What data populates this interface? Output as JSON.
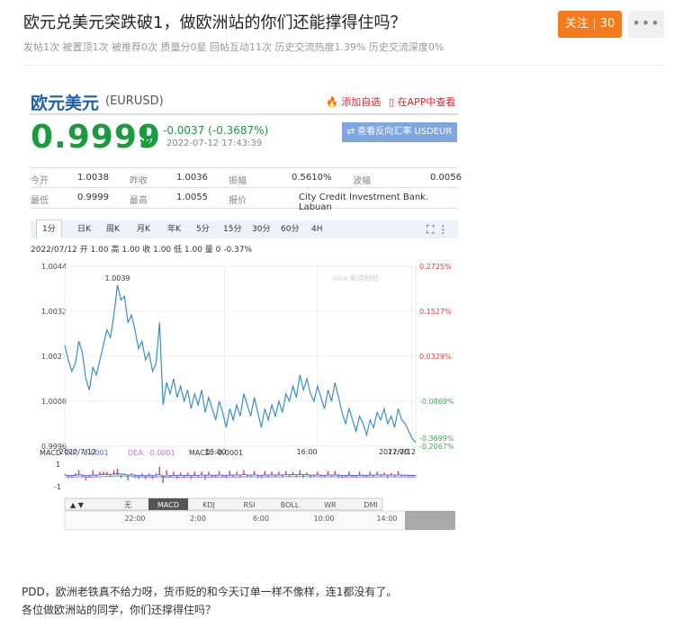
{
  "post": {
    "title": "欧元兑美元突跌破1，做欧洲站的你们还能撑得住吗？",
    "meta": "发帖1次 被置顶1次 被推荐0次 质量分0星 回帖互动11次 历史交流热度1.39% 历史交流深度0%",
    "follow_label": "关注",
    "follow_count": "30",
    "more_label": "•••",
    "body_lines": [
      "PDD，欧洲老铁真不给力呀，货币贬的和今天订单一样不像样，连1都没有了。",
      "各位做欧洲站的同学，你们还撑得住吗？"
    ]
  },
  "quote": {
    "name": "欧元美元",
    "code": "(EURUSD)",
    "add_fav": "添加自选",
    "app_view": "在APP中查看",
    "price": "0.9999",
    "arrow": "↓",
    "change": "-0.0037 (-0.3687%)",
    "datetime": "2022-07-12 17:43:39",
    "reverse_btn": "⇄ 查看反向汇率 USDEUR",
    "rows": [
      [
        [
          "今开",
          "1.0038"
        ],
        [
          "昨收",
          "1.0036"
        ],
        [
          "振幅",
          "0.5610%"
        ],
        [
          "波幅",
          "0.0056"
        ]
      ],
      [
        [
          "最低",
          "0.9999"
        ],
        [
          "最高",
          "1.0055"
        ],
        [
          "报价",
          "City Credit Investment Bank. Labuan"
        ]
      ]
    ],
    "tabs": [
      "1分",
      "日K",
      "周K",
      "月K",
      "年K",
      "5分",
      "15分",
      "30分",
      "60分",
      "4H"
    ],
    "ohlc": "2022/07/12 开 1.00 高 1.00 收 1.00 低 1.00 量 0 -0.37%",
    "tool_icons": "⛶  ⋮",
    "watermark": "sina 新浪财经",
    "indicator_tabs": [
      "无",
      "MACD",
      "KDJ",
      "RSI",
      "BOLL",
      "WR",
      "DMI"
    ],
    "nav_arrows": "▲ ▼",
    "macd": {
      "label": "MACD",
      "dif": "DIF: -0.0001",
      "dea": "DEA: -0.0001",
      "macd": "MACD: -0.0001",
      "y_ticks": [
        "1",
        "-1"
      ]
    }
  },
  "chart_data": {
    "type": "line",
    "title": "",
    "y_ticks_left": [
      "1.0044",
      "1.0032",
      "1.002",
      "1.0008",
      "0.9996"
    ],
    "y_ticks_right": [
      "0.2725%",
      "0.1527%",
      "0.0329%",
      "-0.0869%",
      "-0.2067%"
    ],
    "x_ticks": [
      "2022/7/12",
      "15:00",
      "16:00",
      "17:00",
      "2022/7/12"
    ],
    "nav_ticks": [
      "22:00",
      "2:00",
      "6:00",
      "10:00",
      "14:00"
    ],
    "ylim": [
      0.9996,
      1.0044
    ],
    "high_label": "1.0039",
    "last_label": "-0.3699%",
    "x": [
      0,
      2,
      4,
      6,
      8,
      10,
      12,
      14,
      16,
      18,
      20,
      22,
      24,
      26,
      28,
      30,
      32,
      34,
      36,
      38,
      40,
      42,
      44,
      46,
      48,
      50,
      52,
      54,
      56,
      58,
      60,
      62,
      64,
      66,
      68,
      70,
      72,
      74,
      76,
      78,
      80,
      82,
      84,
      86,
      88,
      90,
      92,
      94,
      96,
      98,
      100,
      102,
      104,
      106,
      108,
      110,
      112,
      114,
      116,
      118,
      120,
      122,
      124,
      126,
      128,
      130,
      132,
      134,
      136,
      138,
      140,
      142,
      144,
      146,
      148,
      150,
      152,
      154,
      156,
      158,
      160,
      162,
      164,
      166,
      168,
      170,
      172,
      174,
      176,
      178,
      180,
      182,
      184,
      186,
      188,
      190,
      192,
      194,
      196,
      198,
      200
    ],
    "values": [
      1.0023,
      1.0019,
      1.0016,
      1.0018,
      1.0024,
      1.0021,
      1.0014,
      1.0011,
      1.0017,
      1.0015,
      1.0019,
      1.0023,
      1.0027,
      1.0025,
      1.0031,
      1.0039,
      1.0035,
      1.0036,
      1.0029,
      1.0031,
      1.0027,
      1.0022,
      1.0024,
      1.0019,
      1.0021,
      1.0016,
      1.0018,
      1.0029,
      1.0007,
      1.0013,
      1.001,
      1.0014,
      1.0009,
      1.0012,
      1.0008,
      1.0011,
      1.0006,
      1.001,
      1.0007,
      1.0011,
      1.0005,
      1.0009,
      1.0006,
      1.0003,
      1.0008,
      1.0005,
      1.0001,
      1.0006,
      1.0003,
      1.0007,
      1.0004,
      1.001,
      1.0007,
      1.0004,
      1.0009,
      1.0005,
      1.0001,
      1.0006,
      1.0003,
      1.0007,
      1.0004,
      1.0008,
      1.0005,
      1.001,
      1.0008,
      1.0012,
      1.0009,
      1.0015,
      1.0011,
      1.0014,
      1.001,
      1.0008,
      1.0012,
      1.0009,
      1.0006,
      1.0011,
      1.0008,
      1.0013,
      1.0009,
      1.0005,
      1.0002,
      1.0006,
      1.0003,
      1.0,
      1.0004,
      1.0002,
      0.9999,
      1.0003,
      1.0001,
      1.0005,
      1.0003,
      1.0006,
      1.0002,
      1.0004,
      1.0001,
      1.0006,
      1.0003,
      1.0002,
      1.0,
      0.9998,
      0.9997
    ]
  },
  "colors": {
    "price_green": "#1c9a3e",
    "line": "#3b8fc4",
    "dif": "#4a6fd6",
    "dea": "#c070d0",
    "bar_up": "#d94040",
    "bar_down": "#3aaa55",
    "accent": "#f47a1e"
  }
}
